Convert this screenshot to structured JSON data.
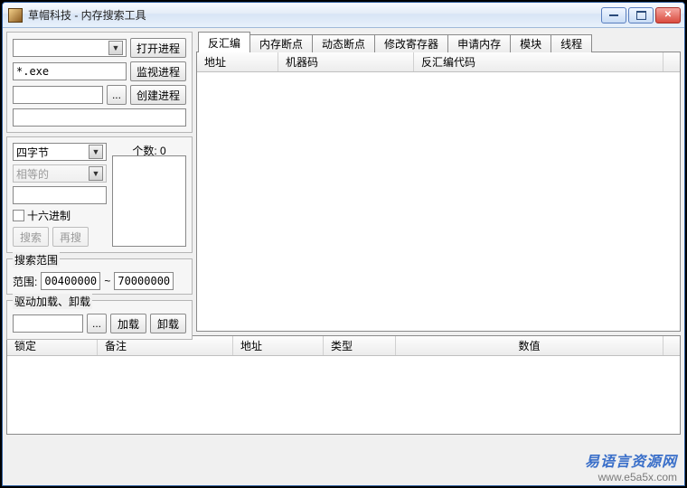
{
  "window": {
    "title": "草帽科技 - 内存搜索工具"
  },
  "left_top": {
    "open_process_btn": "打开进程",
    "exe_filter": "*.exe",
    "monitor_process_btn": "监视进程",
    "browse_btn": "...",
    "create_process_btn": "创建进程"
  },
  "search_panel": {
    "count_label": "个数: 0",
    "datatype_value": "四字节",
    "compare_value": "相等的",
    "hex_checkbox_label": "十六进制",
    "search_btn": "搜索",
    "research_btn": "再搜"
  },
  "range_group": {
    "legend": "搜索范围",
    "range_label": "范围:",
    "from": "00400000",
    "sep": "~",
    "to": "70000000"
  },
  "driver_group": {
    "legend": "驱动加载、卸载",
    "browse_btn": "...",
    "load_btn": "加载",
    "unload_btn": "卸载"
  },
  "tabs": {
    "items": [
      "反汇编",
      "内存断点",
      "动态断点",
      "修改寄存器",
      "申请内存",
      "模块",
      "线程"
    ],
    "active_index": 0
  },
  "disasm_headers": {
    "addr": "地址",
    "opcode": "机器码",
    "disasm": "反汇编代码"
  },
  "lower_headers": {
    "lock": "锁定",
    "remark": "备注",
    "addr": "地址",
    "type": "类型",
    "value": "数值"
  },
  "watermark": {
    "line1": "易语言资源网",
    "line2": "www.e5a5x.com"
  }
}
